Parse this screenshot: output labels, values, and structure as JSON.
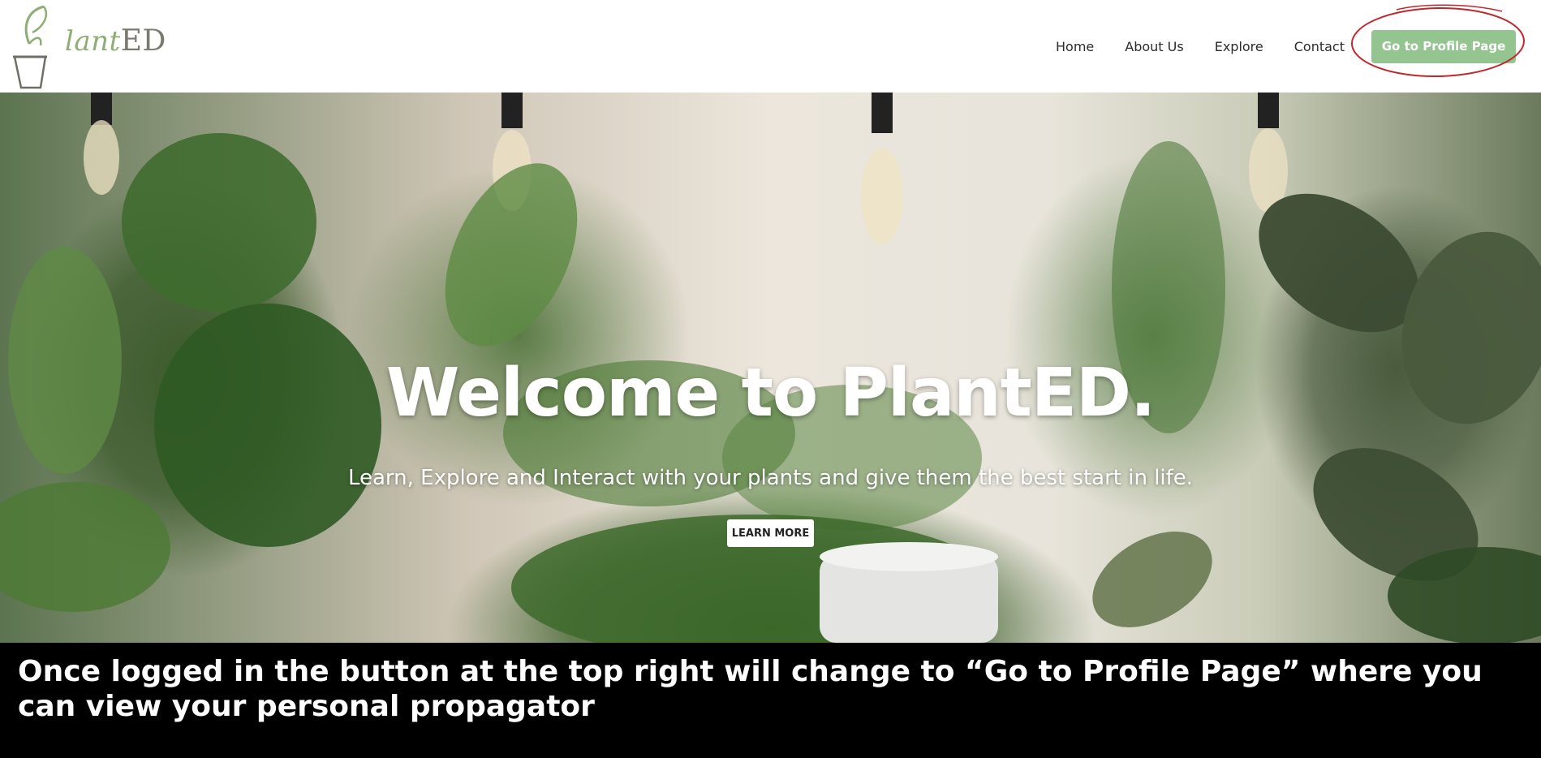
{
  "logo": {
    "script_part": "lant",
    "caps_part": "ED"
  },
  "nav": {
    "items": [
      {
        "label": "Home"
      },
      {
        "label": "About Us"
      },
      {
        "label": "Explore"
      },
      {
        "label": "Contact"
      }
    ],
    "profile_button": "Go to Profile Page"
  },
  "hero": {
    "title": "Welcome to PlantED.",
    "subtitle": "Learn, Explore and Interact with your plants and give them the best start in life.",
    "cta": "LEARN MORE"
  },
  "caption": {
    "text": "Once logged in the button at the top right will change to “Go to Profile Page” where you can view your personal propagator"
  },
  "colors": {
    "accent": "#94c48f",
    "logo_green": "#8fae74",
    "annotation": "#c0282d"
  }
}
